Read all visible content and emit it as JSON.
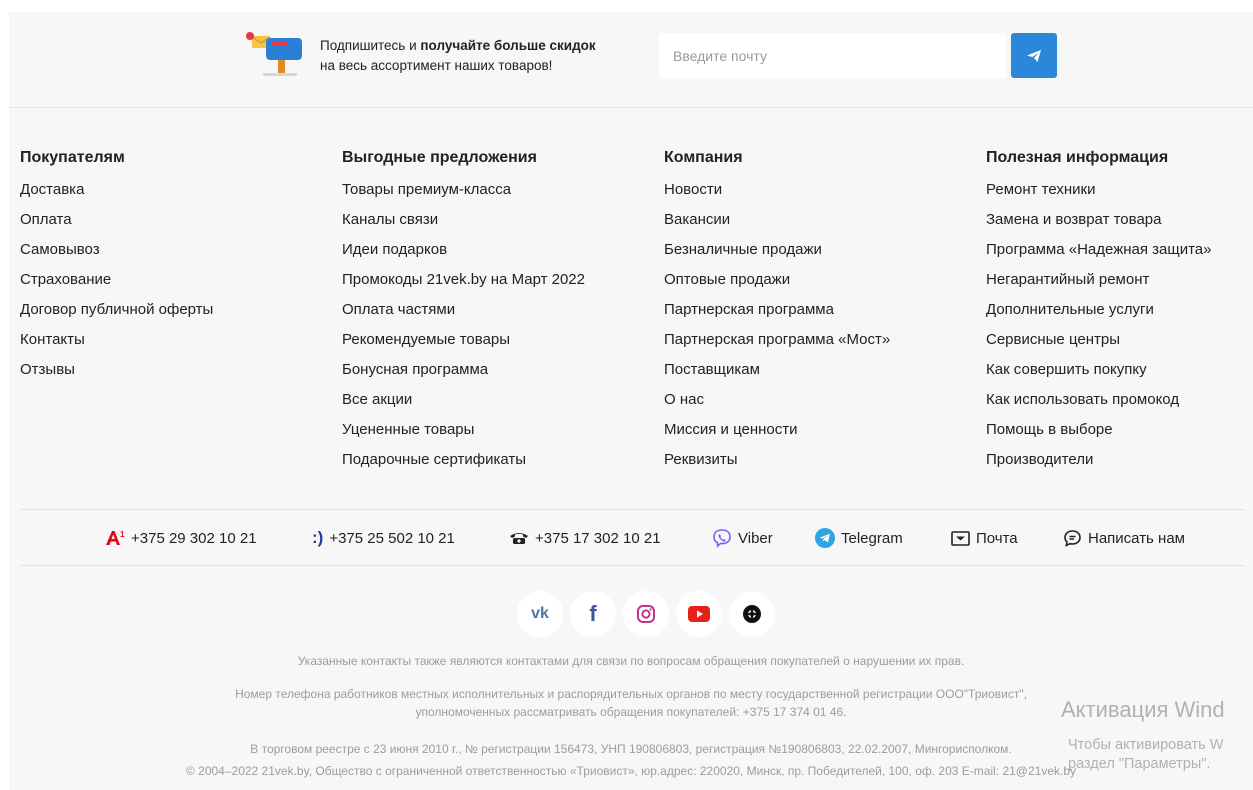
{
  "subscribe": {
    "text_plain": "Подпишитесь и ",
    "text_bold": "получайте больше скидок",
    "text_line2": "на весь ассортимент наших товаров!",
    "email_placeholder": "Введите почту",
    "notification_count": "",
    "button_icon": "send-icon"
  },
  "columns": [
    {
      "title": "Покупателям",
      "items": [
        "Доставка",
        "Оплата",
        "Самовывоз",
        "Страхование",
        "Договор публичной оферты",
        "Контакты",
        "Отзывы"
      ]
    },
    {
      "title": "Выгодные предложения",
      "items": [
        "Товары премиум-класса",
        "Каналы связи",
        "Идеи подарков",
        "Промокоды 21vek.by на Март 2022",
        "Оплата частями",
        "Рекомендуемые товары",
        "Бонусная программа",
        "Все акции",
        "Уцененные товары",
        "Подарочные сертификаты"
      ]
    },
    {
      "title": "Компания",
      "items": [
        "Новости",
        "Вакансии",
        "Безналичные продажи",
        "Оптовые продажи",
        "Партнерская программа",
        "Партнерская программа «Мост»",
        "Поставщикам",
        "О нас",
        "Миссия и ценности",
        "Реквизиты"
      ]
    },
    {
      "title": "Полезная информация",
      "items": [
        "Ремонт техники",
        "Замена и возврат товара",
        "Программа «Надежная защита»",
        "Негарантийный ремонт",
        "Дополнительные услуги",
        "Сервисные центры",
        "Как совершить покупку",
        "Как использовать промокод",
        "Помощь в выборе",
        "Производители"
      ]
    }
  ],
  "contacts": {
    "a1_phone": "+375 29 302 10 21",
    "life_phone": "+375 25 502 10 21",
    "landline_phone": "+375 17 302 10 21",
    "viber": "Viber",
    "telegram": "Telegram",
    "mail": "Почта",
    "write": "Написать нам"
  },
  "socials": [
    "vk-icon",
    "facebook-icon",
    "instagram-icon",
    "youtube-icon",
    "odnoklassniki-icon"
  ],
  "legal": {
    "line1": "Указанные контакты также являются контактами для связи по вопросам обращения покупателей о нарушении их прав.",
    "line2a": "Номер телефона работников местных исполнительных и распорядительных органов по месту государственной регистрации ООО\"Триовист\",",
    "line2b": "уполномоченных рассматривать обращения покупателей: +375 17 374 01 46.",
    "line3": "В торговом реестре с 23 июня 2010 г., № регистрации 156473, УНП 190806803, регистрация №190806803, 22.02.2007, Мингорисполком.",
    "line4": "© 2004–2022 21vek.by, Общество с ограниченной ответственностью «Триовист», юр.адрес: 220020, Минск, пр. Победителей, 100, оф. 203 E-mail: 21@21vek.by"
  },
  "watermark": {
    "title": "Активация Wind",
    "line1": "Чтобы активировать W",
    "line2": "раздел \"Параметры\"."
  },
  "colors": {
    "accent": "#2b88d8",
    "a1_red": "#e3051b",
    "viber_purple": "#7360f2",
    "telegram_blue": "#2ca5e0",
    "vk_blue": "#4a76a8",
    "facebook_blue": "#3b5998",
    "instagram_pink": "#c13584",
    "youtube_red": "#e62117"
  }
}
